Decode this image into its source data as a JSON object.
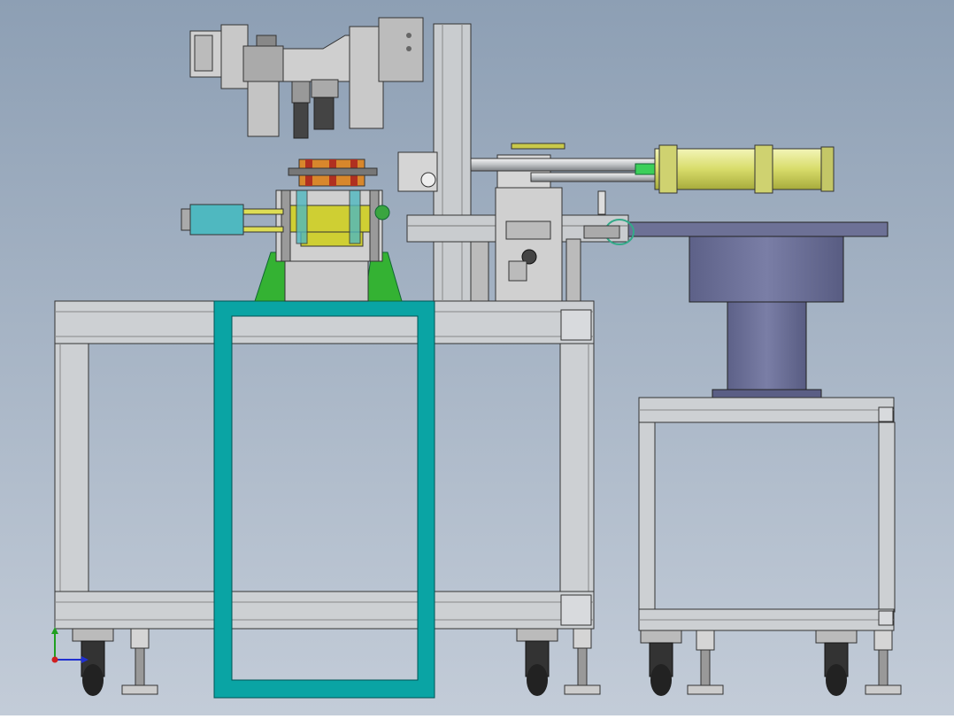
{
  "scene": {
    "description_free": true,
    "colors": {
      "background_top": "#8d9fb4",
      "background_bottom": "#c3ccd8",
      "frame": "#c9cccf",
      "frame_dark": "#8c9095",
      "outline": "#2a2a2a",
      "highlight_box": "#0aa4a4",
      "turntable": "#6b6f96",
      "turntable_dark": "#4f527a",
      "cylinder": "#e5e88a",
      "fixture_green": "#34b233",
      "fixture_yellow": "#cfcf33",
      "coil_orange": "#d8872c",
      "coil_red": "#b03020",
      "cyan_part": "#4fb8c0",
      "wheel": "#222222"
    },
    "axis_triad": {
      "x_color": "#d02020",
      "y_color": "#20a020",
      "z_color": "#2030d0"
    }
  }
}
